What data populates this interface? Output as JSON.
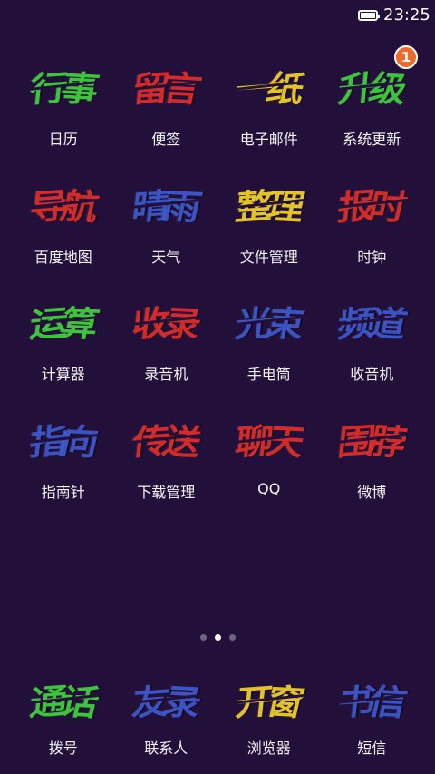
{
  "status_bar": {
    "time": "23:25",
    "battery_icon": "battery-full-icon"
  },
  "colors": {
    "background": "#23103a",
    "green": "#3dc43d",
    "red": "#d42a2a",
    "yellow": "#e4c326",
    "blue": "#3b54c4",
    "badge": "#f06a2a"
  },
  "apps": [
    {
      "label": "日历",
      "icon_text": "行事",
      "color": "#3dc43d",
      "badge": ""
    },
    {
      "label": "便签",
      "icon_text": "留言",
      "color": "#d42a2a",
      "badge": ""
    },
    {
      "label": "电子邮件",
      "icon_text": "一纸",
      "color": "#e4c326",
      "badge": ""
    },
    {
      "label": "系统更新",
      "icon_text": "升级",
      "color": "#3dc43d",
      "badge": "1"
    },
    {
      "label": "百度地图",
      "icon_text": "导航",
      "color": "#d42a2a",
      "badge": ""
    },
    {
      "label": "天气",
      "icon_text": "晴雨",
      "color": "#3b54c4",
      "badge": ""
    },
    {
      "label": "文件管理",
      "icon_text": "整理",
      "color": "#e4c326",
      "badge": ""
    },
    {
      "label": "时钟",
      "icon_text": "报时",
      "color": "#d42a2a",
      "badge": ""
    },
    {
      "label": "计算器",
      "icon_text": "运算",
      "color": "#3dc43d",
      "badge": ""
    },
    {
      "label": "录音机",
      "icon_text": "收录",
      "color": "#d42a2a",
      "badge": ""
    },
    {
      "label": "手电筒",
      "icon_text": "光束",
      "color": "#3b54c4",
      "badge": ""
    },
    {
      "label": "收音机",
      "icon_text": "频道",
      "color": "#3b54c4",
      "badge": ""
    },
    {
      "label": "指南针",
      "icon_text": "指向",
      "color": "#3b54c4",
      "badge": ""
    },
    {
      "label": "下载管理",
      "icon_text": "传送",
      "color": "#d42a2a",
      "badge": ""
    },
    {
      "label": "QQ",
      "icon_text": "聊天",
      "color": "#d42a2a",
      "badge": ""
    },
    {
      "label": "微博",
      "icon_text": "围脖",
      "color": "#d42a2a",
      "badge": ""
    }
  ],
  "pager": {
    "pages": 3,
    "active": 2
  },
  "dock": [
    {
      "label": "拨号",
      "icon_text": "通话",
      "color": "#3dc43d"
    },
    {
      "label": "联系人",
      "icon_text": "友录",
      "color": "#3b54c4"
    },
    {
      "label": "浏览器",
      "icon_text": "开窗",
      "color": "#e4c326"
    },
    {
      "label": "短信",
      "icon_text": "书信",
      "color": "#3b54c4"
    }
  ]
}
